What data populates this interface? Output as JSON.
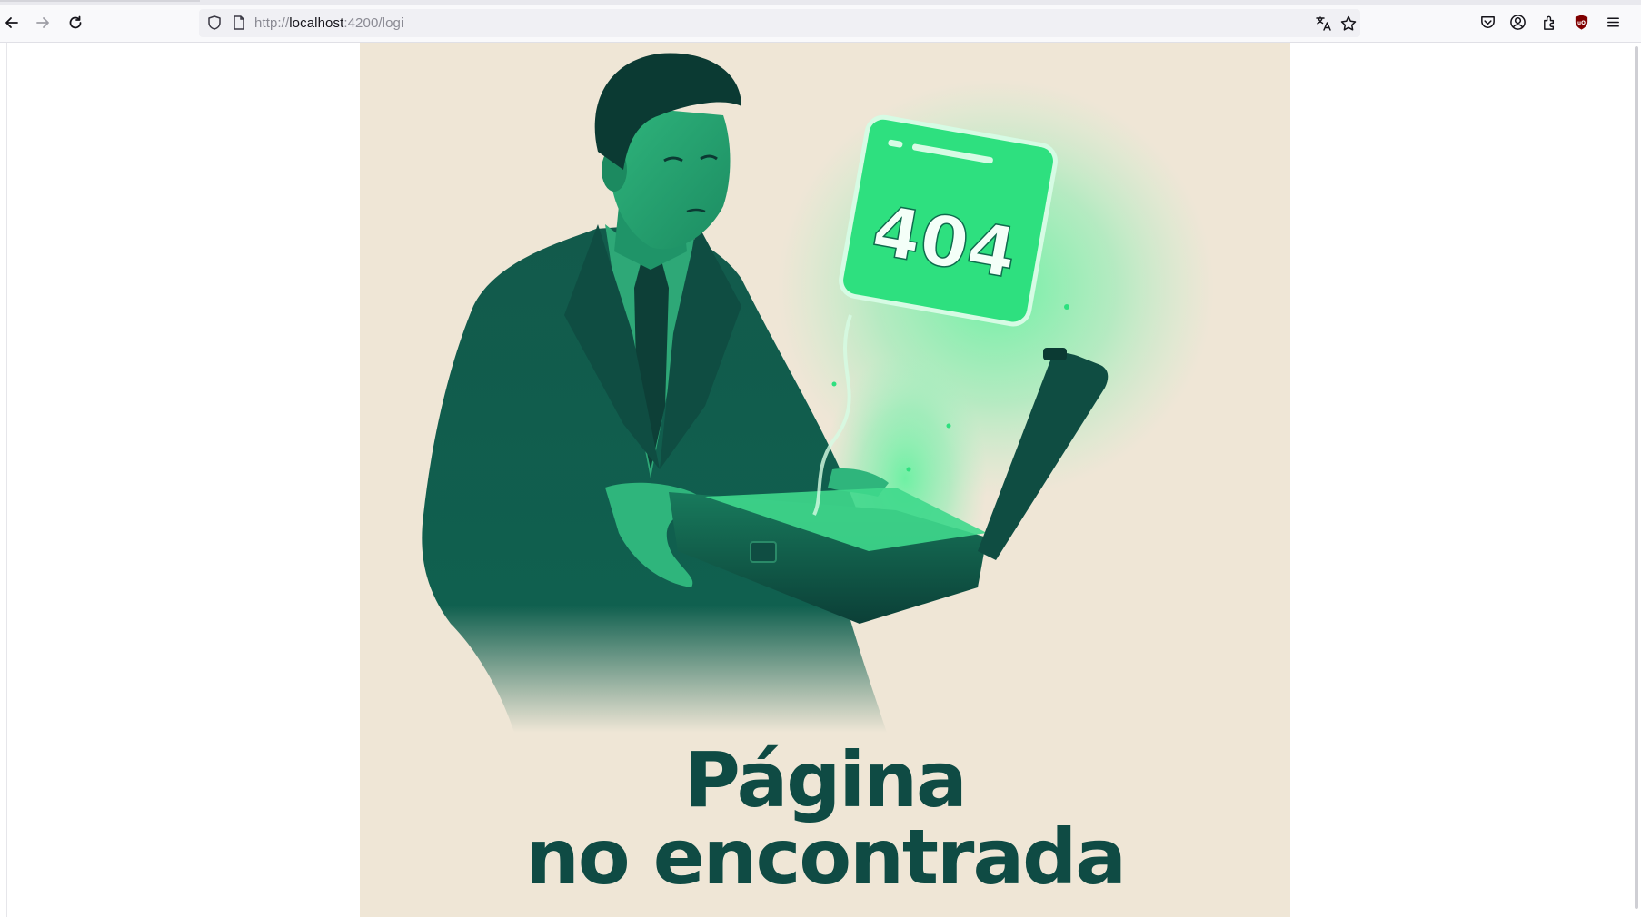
{
  "browser": {
    "url_prefix": "http://",
    "url_host": "localhost",
    "url_rest": ":4200/logi",
    "icons": [
      "back-arrow-icon",
      "forward-arrow-icon",
      "reload-icon",
      "shield-icon",
      "page-icon",
      "translate-icon",
      "bookmark-star-icon",
      "pocket-icon",
      "account-icon",
      "extensions-icon",
      "ublock-icon",
      "menu-icon"
    ]
  },
  "page": {
    "illustration_code": "404",
    "title_line1": "Página",
    "title_line2": "no encontrada"
  },
  "colors": {
    "background": "#efe6d6",
    "ink": "#0f4b44",
    "glow": "#2ee07f",
    "suit": "#14604f"
  }
}
